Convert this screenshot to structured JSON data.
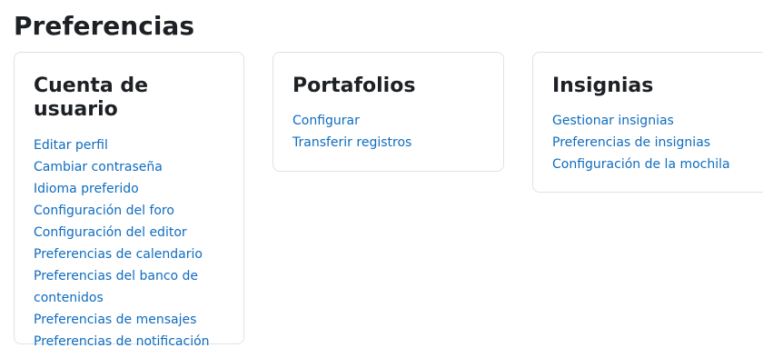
{
  "page": {
    "title": "Preferencias"
  },
  "sections": [
    {
      "title": "Cuenta de usuario",
      "links": [
        "Editar perfil",
        "Cambiar contraseña",
        "Idioma preferido",
        "Configuración del foro",
        "Configuración del editor",
        "Preferencias de calendario",
        "Preferencias del banco de contenidos",
        "Preferencias de mensajes",
        "Preferencias de notificación"
      ]
    },
    {
      "title": "Portafolios",
      "links": [
        "Configurar",
        "Transferir registros"
      ]
    },
    {
      "title": "Insignias",
      "links": [
        "Gestionar insignias",
        "Preferencias de insignias",
        "Configuración de la mochila"
      ]
    }
  ],
  "colors": {
    "link": "#0f6cbf",
    "text": "#1d2125",
    "border": "#dee2e6"
  }
}
